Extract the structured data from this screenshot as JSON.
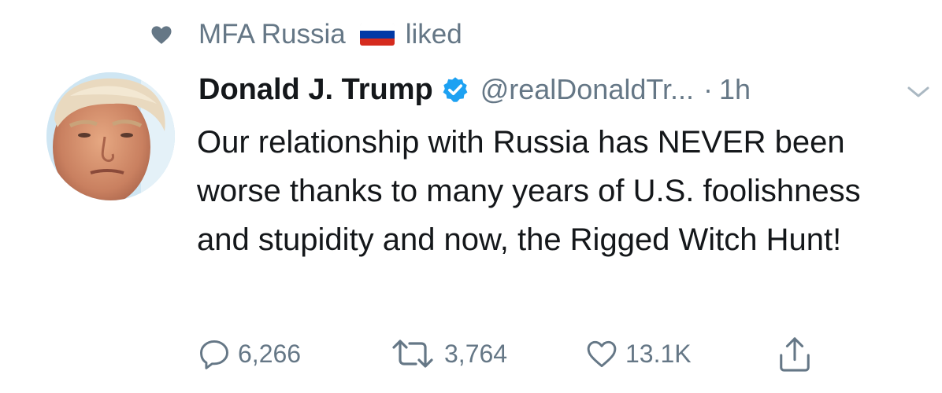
{
  "social_context": {
    "liker": "MFA Russia",
    "action": "liked",
    "flag_colors": [
      "#ffffff",
      "#0039a6",
      "#d52b1e"
    ],
    "icon": "heart-icon"
  },
  "tweet": {
    "author": {
      "display_name": "Donald J. Trump",
      "handle": "@realDonaldTr...",
      "verified": true,
      "verified_color": "#1da1f2"
    },
    "separator": "·",
    "timestamp": "1h",
    "text": "Our relationship with Russia has NEVER been worse thanks to many years of U.S. foolishness and stupidity and now, the Rigged Witch Hunt!",
    "actions": {
      "replies": "6,266",
      "retweets": "3,764",
      "likes": "13.1K"
    }
  },
  "colors": {
    "text_primary": "#14171a",
    "text_secondary": "#657786",
    "accent": "#1da1f2"
  }
}
